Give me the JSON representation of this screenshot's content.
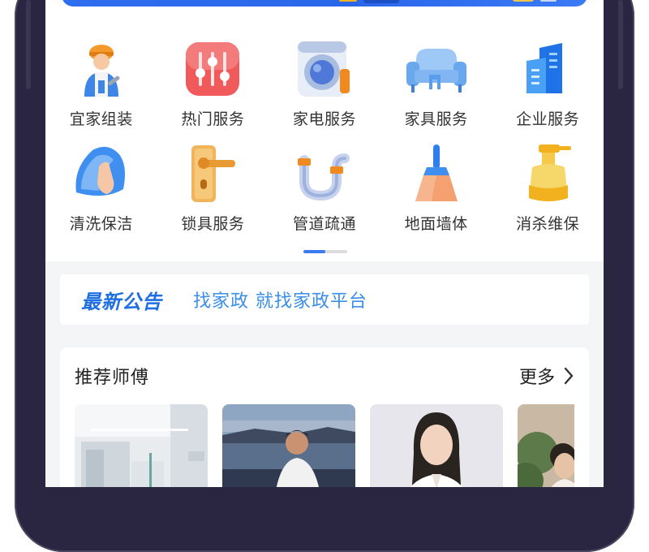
{
  "services": [
    {
      "label": "宜家组装",
      "icon": "worker-icon"
    },
    {
      "label": "热门服务",
      "icon": "sliders-icon"
    },
    {
      "label": "家电服务",
      "icon": "washing-machine-icon"
    },
    {
      "label": "家具服务",
      "icon": "sofa-icon"
    },
    {
      "label": "企业服务",
      "icon": "building-icon"
    },
    {
      "label": "清洗保洁",
      "icon": "cleaning-cloth-icon"
    },
    {
      "label": "锁具服务",
      "icon": "door-lock-icon"
    },
    {
      "label": "管道疏通",
      "icon": "pipe-icon"
    },
    {
      "label": "地面墙体",
      "icon": "broom-icon"
    },
    {
      "label": "消杀维保",
      "icon": "spray-bottle-icon"
    }
  ],
  "pager": {
    "active_fraction": 0.5
  },
  "notice": {
    "tag": "最新公告",
    "text": "找家政 就找家政平台"
  },
  "recommend": {
    "title": "推荐师傅",
    "more_label": "更多",
    "photos": [
      {
        "name": "photo-interior"
      },
      {
        "name": "photo-man-seaside"
      },
      {
        "name": "photo-woman-portrait"
      },
      {
        "name": "photo-person-plants"
      }
    ]
  },
  "colors": {
    "accent_blue": "#1f6fe0",
    "notice_text": "#3a8ee8",
    "pager_active": "#3a7bf2"
  }
}
